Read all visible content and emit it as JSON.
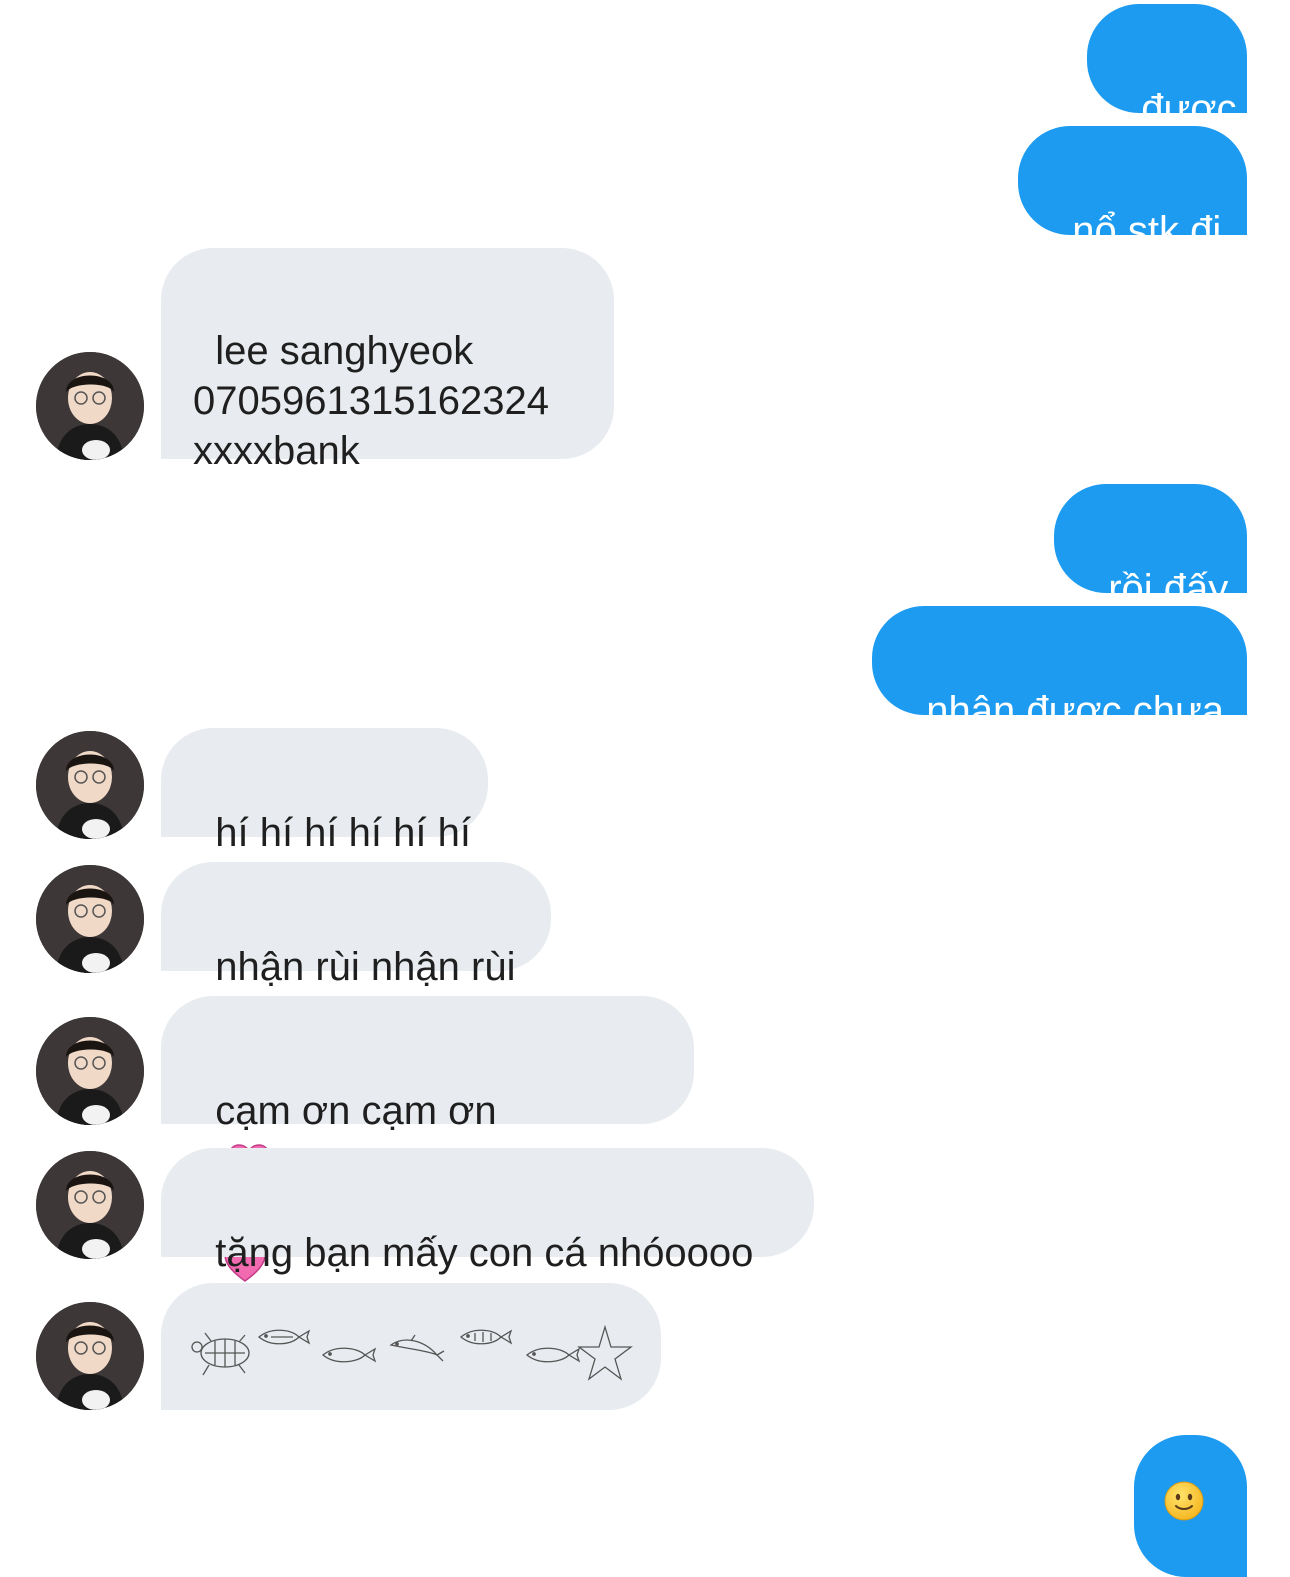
{
  "conversation": {
    "messages": [
      {
        "side": "out",
        "text": "được"
      },
      {
        "side": "out",
        "text": "nổ stk đi"
      },
      {
        "side": "in",
        "text": "lee sanghyeok\n0705961315162324\nxxxxbank"
      },
      {
        "side": "out",
        "text": "rồi đấy"
      },
      {
        "side": "out",
        "text": "nhận được chưa"
      },
      {
        "side": "in",
        "text": "hí hí hí hí hí hí"
      },
      {
        "side": "in",
        "text": "nhận rùi nhận rùi"
      },
      {
        "side": "in",
        "text": "cạm ơn cạm ơn",
        "emoji": [
          "heart-icon",
          "heart-icon",
          "heart-icon"
        ]
      },
      {
        "side": "in",
        "text": "tặng bạn mấy con cá nhóoooo"
      },
      {
        "side": "in",
        "emoji": [
          "turtle-icon",
          "fish-icon",
          "fish-icon",
          "dolphin-icon",
          "fish-icon",
          "fish-icon",
          "starfish-icon"
        ]
      },
      {
        "side": "out",
        "emoji": [
          "smiling-face-icon"
        ]
      }
    ]
  },
  "colors": {
    "outgoing_bubble": "#1d9bf0",
    "incoming_bubble": "#e8ecf0",
    "heart": "#f26ab0"
  }
}
